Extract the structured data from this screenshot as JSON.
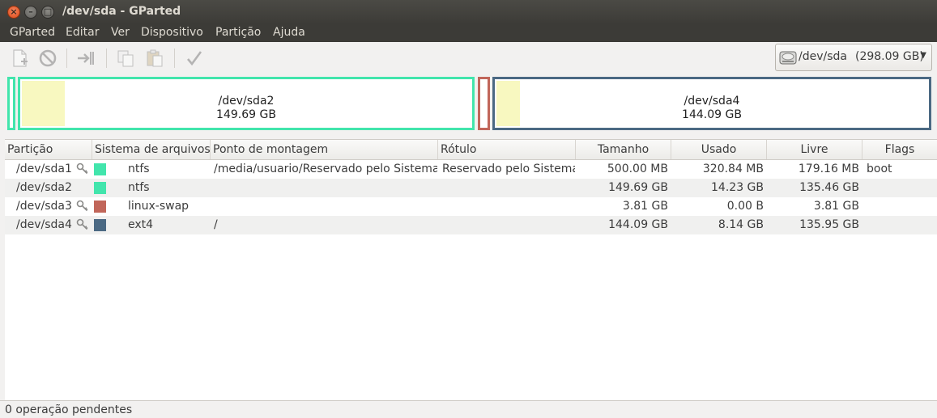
{
  "window": {
    "title": "/dev/sda - GParted"
  },
  "menu": [
    "GParted",
    "Editar",
    "Ver",
    "Dispositivo",
    "Partição",
    "Ajuda"
  ],
  "toolbar": {
    "icons": [
      "new-partition-icon",
      "delete-partition-icon",
      "resize-move-icon",
      "copy-icon",
      "paste-icon",
      "apply-icon"
    ]
  },
  "device": {
    "name": "/dev/sda",
    "size": "(298.09 GB)"
  },
  "partition_map": [
    {
      "name": "/dev/sda2",
      "size": "149.69 GB",
      "color": "#42e5ac"
    },
    {
      "name": "/dev/sda4",
      "size": "144.09 GB",
      "color": "#4b6983"
    }
  ],
  "table": {
    "headers": [
      "Partição",
      "Sistema de arquivos",
      "Ponto de montagem",
      "Rótulo",
      "Tamanho",
      "Usado",
      "Livre",
      "Flags"
    ],
    "rows": [
      {
        "partition": "/dev/sda1",
        "fs": "ntfs",
        "fs_color": "#42e5ac",
        "mount": "/media/usuario/Reservado pelo Sistema",
        "label": "Reservado pelo Sistema",
        "size": "500.00 MB",
        "used": "320.84 MB",
        "free": "179.16 MB",
        "flags": "boot"
      },
      {
        "partition": "/dev/sda2",
        "fs": "ntfs",
        "fs_color": "#42e5ac",
        "mount": "",
        "label": "",
        "size": "149.69 GB",
        "used": "14.23 GB",
        "free": "135.46 GB",
        "flags": ""
      },
      {
        "partition": "/dev/sda3",
        "fs": "linux-swap",
        "fs_color": "#c1665a",
        "mount": "",
        "label": "",
        "size": "3.81 GB",
        "used": "0.00 B",
        "free": "3.81 GB",
        "flags": ""
      },
      {
        "partition": "/dev/sda4",
        "fs": "ext4",
        "fs_color": "#4b6983",
        "mount": "/",
        "label": "",
        "size": "144.09 GB",
        "used": "8.14 GB",
        "free": "135.95 GB",
        "flags": ""
      }
    ]
  },
  "status": {
    "text": "0 operação pendentes"
  }
}
